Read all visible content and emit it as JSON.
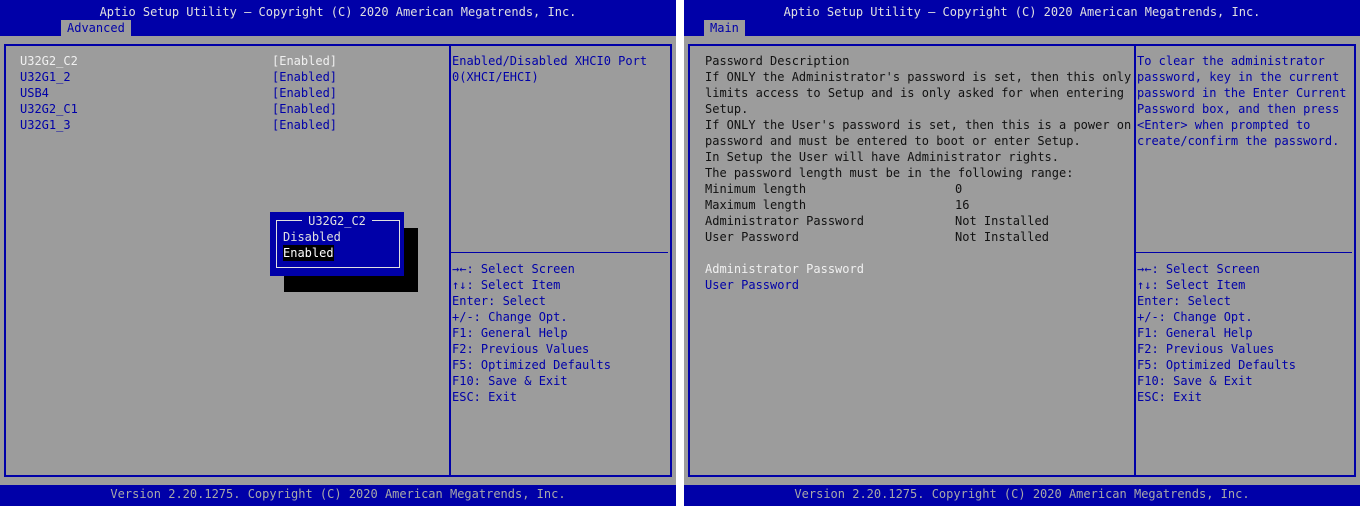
{
  "left": {
    "title": "Aptio Setup Utility – Copyright (C) 2020 American Megatrends, Inc.",
    "tab": "Advanced",
    "items": [
      {
        "label": "U32G2_C2",
        "value": "[Enabled]"
      },
      {
        "label": "U32G1_2",
        "value": "[Enabled]"
      },
      {
        "label": "USB4",
        "value": "[Enabled]"
      },
      {
        "label": "U32G2_C1",
        "value": "[Enabled]"
      },
      {
        "label": "U32G1_3",
        "value": "[Enabled]"
      }
    ],
    "help": [
      "Enabled/Disabled XHCI0 Port",
      "0(XHCI/EHCI)"
    ],
    "popup": {
      "title": "U32G2_C2",
      "options": [
        "Disabled",
        "Enabled"
      ],
      "selected": "Enabled"
    },
    "keys": [
      "→←: Select Screen",
      "↑↓: Select Item",
      "Enter: Select",
      "+/-: Change Opt.",
      "F1: General Help",
      "F2: Previous Values",
      "F5: Optimized Defaults",
      "F10: Save & Exit",
      "ESC: Exit"
    ],
    "footer": "Version 2.20.1275. Copyright (C) 2020 American Megatrends, Inc."
  },
  "right": {
    "title": "Aptio Setup Utility – Copyright (C) 2020 American Megatrends, Inc.",
    "tab": "Main",
    "desc": [
      "Password Description",
      "If ONLY the Administrator's password is set, then this only",
      "limits access to Setup and is only asked for when entering",
      "Setup.",
      "If ONLY the User's password is set, then this is a power on",
      "password and must be entered to boot or enter Setup.",
      "In Setup the User will have Administrator rights.",
      "The password length must be in the following range:"
    ],
    "info": [
      {
        "label": "Minimum length",
        "value": "0"
      },
      {
        "label": "Maximum length",
        "value": "16"
      },
      {
        "label": "Administrator Password",
        "value": "Not Installed"
      },
      {
        "label": "User Password",
        "value": "Not Installed"
      }
    ],
    "links": [
      "Administrator Password",
      "User Password"
    ],
    "help": [
      "To clear the administrator",
      "password, key in the current",
      "password in the Enter Current",
      "Password box, and then press",
      "<Enter> when prompted to",
      "create/confirm the password."
    ],
    "keys": [
      "→←: Select Screen",
      "↑↓: Select Item",
      "Enter: Select",
      "+/-: Change Opt.",
      "F1: General Help",
      "F2: Previous Values",
      "F5: Optimized Defaults",
      "F10: Save & Exit",
      "ESC: Exit"
    ],
    "footer": "Version 2.20.1275. Copyright (C) 2020 American Megatrends, Inc."
  }
}
